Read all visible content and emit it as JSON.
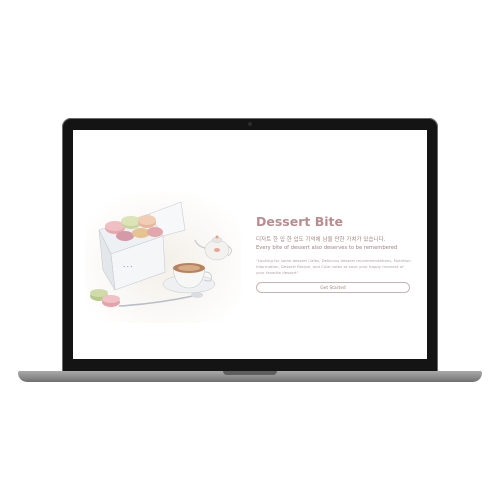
{
  "hero": {
    "title": "Dessert Bite",
    "tagline_ko": "디저트 한 입 한 입도 기억에 남을 만한 가치가 있습니다.",
    "tagline_en": "Every bite of dessert also deserves to be remembered",
    "blurb": "\"Looking for some dessert Cafes, Delicious dessert recommendations, Nutrition information, Dessert Recipe, and Cute notes to save your happy moment of your favorite dessert\"",
    "cta_label": "Get Started"
  },
  "colors": {
    "accent": "#b98d8f",
    "text_muted": "#a07f81",
    "laptop_bezel": "#141414",
    "laptop_base": "#8a8a8a"
  },
  "illustration": {
    "subject": "watercolor macarons box with teacup and teapot"
  }
}
